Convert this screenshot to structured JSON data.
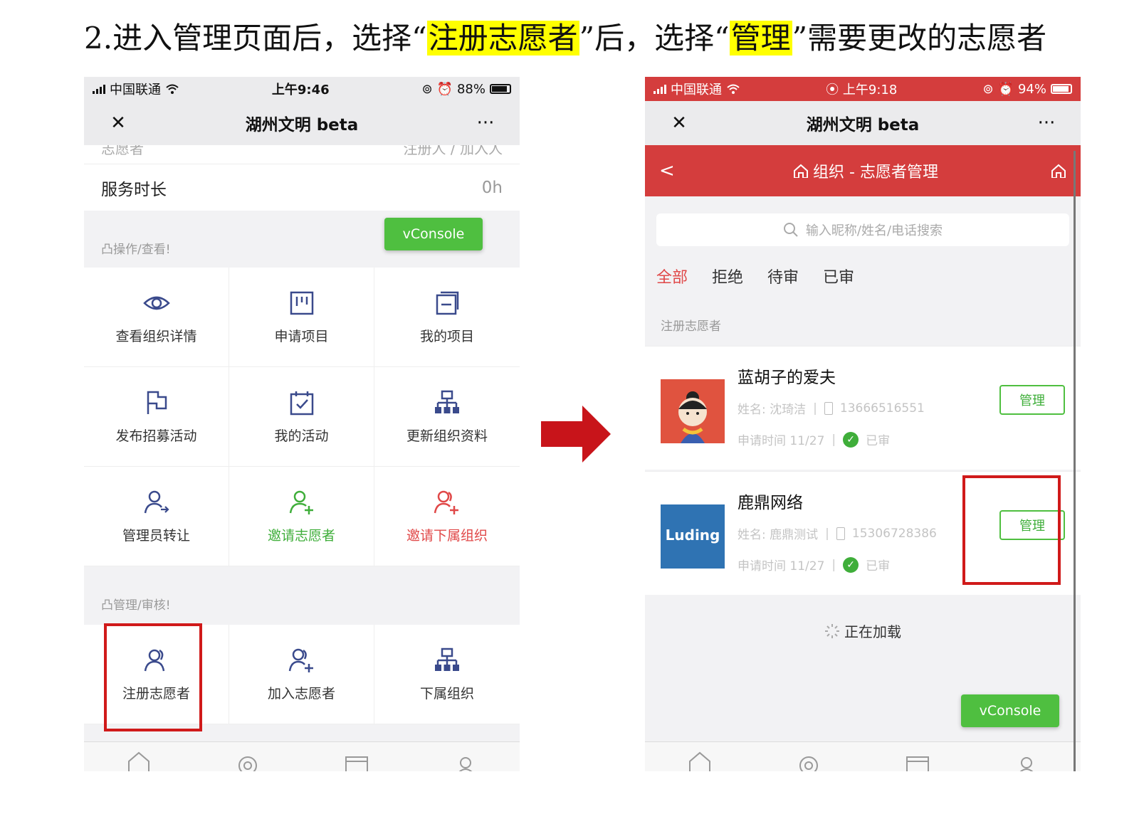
{
  "instruction": {
    "prefix": "2.进入管理页面后，选择",
    "open_quote": "“",
    "close_quote": "”",
    "highlight1": "注册志愿者",
    "middle": "后，选择",
    "highlight2": "管理",
    "suffix": "需要更改的志愿者"
  },
  "left_phone": {
    "status": {
      "carrier": "中国联通",
      "time": "上午9:46",
      "battery": "88%",
      "battery_level": 0.88
    },
    "nav": {
      "close": "✕",
      "title": "湖州文明 beta",
      "more": "···"
    },
    "partial_row": {
      "label": "志愿者",
      "value": "注册人 / 加入人"
    },
    "service_row": {
      "label": "服务时长",
      "value": "0h"
    },
    "vconsole": "vConsole",
    "operate_section": "凸操作/查看!",
    "operate_items": [
      {
        "label": "查看组织详情",
        "icon": "eye-icon"
      },
      {
        "label": "申请项目",
        "icon": "kanban-icon"
      },
      {
        "label": "我的项目",
        "icon": "folder-icon"
      },
      {
        "label": "发布招募活动",
        "icon": "flag-icon"
      },
      {
        "label": "我的活动",
        "icon": "calendar-check-icon"
      },
      {
        "label": "更新组织资料",
        "icon": "org-chart-icon"
      },
      {
        "label": "管理员转让",
        "icon": "user-transfer-icon"
      },
      {
        "label": "邀请志愿者",
        "icon": "user-add-icon"
      },
      {
        "label": "邀请下属组织",
        "icon": "users-add-icon"
      }
    ],
    "manage_section": "凸管理/审核!",
    "manage_items": [
      {
        "label": "注册志愿者",
        "icon": "users-icon"
      },
      {
        "label": "加入志愿者",
        "icon": "users-plus-icon"
      },
      {
        "label": "下属组织",
        "icon": "org-chart-icon"
      }
    ],
    "tabbar": [
      "home-icon",
      "discover-icon",
      "card-icon",
      "user-icon"
    ]
  },
  "right_phone": {
    "status": {
      "carrier": "中国联通",
      "time": "上午9:18",
      "battery": "94%",
      "battery_level": 0.94
    },
    "nav": {
      "close": "✕",
      "title": "湖州文明 beta",
      "more": "···"
    },
    "header": {
      "back": "<",
      "title": "组织 - 志愿者管理"
    },
    "search_placeholder": "输入昵称/姓名/电话搜索",
    "filters": [
      "全部",
      "拒绝",
      "待审",
      "已审"
    ],
    "list_label": "注册志愿者",
    "volunteers": [
      {
        "nickname": "蓝胡子的爱夫",
        "name_label": "姓名: 沈琦洁",
        "phone": "13666516551",
        "apply_time": "申请时间 11/27",
        "status": "已审",
        "action": "管理"
      },
      {
        "nickname": "鹿鼎网络",
        "name_label": "姓名: 鹿鼎测试",
        "phone": "15306728386",
        "apply_time": "申请时间 11/27",
        "status": "已审",
        "action": "管理",
        "avatar_text": "Luding"
      }
    ],
    "loading": "正在加载",
    "vconsole": "vConsole"
  },
  "colors": {
    "wechat_green": "#4fbf40",
    "header_red": "#d43d3d",
    "highlight": "#ffff00",
    "annotation_red": "#d01a1a"
  }
}
